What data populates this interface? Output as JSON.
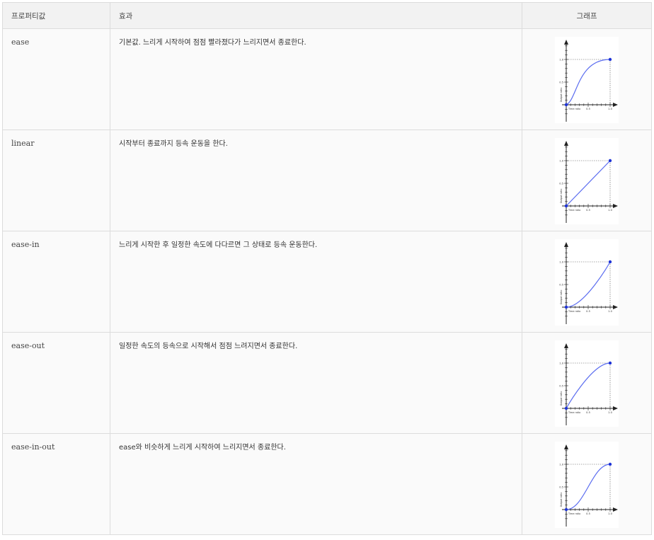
{
  "table": {
    "headers": {
      "property": "프로퍼티값",
      "effect": "효과",
      "graph": "그래프"
    },
    "rows": [
      {
        "value": "ease",
        "effect": "기본값. 느리게 시작하여 점점 빨라졌다가 느리지면서 종료한다.",
        "curve": "ease"
      },
      {
        "value": "linear",
        "effect": "시작부터 종료까지 등속 운동을 한다.",
        "curve": "linear"
      },
      {
        "value": "ease-in",
        "effect": "느리게 시작한 후 일정한 속도에 다다르면 그 상태로 등속 운동한다.",
        "curve": "ease-in"
      },
      {
        "value": "ease-out",
        "effect": "일정한 속도의 등속으로 시작해서 점점 느려지면서 종료한다.",
        "curve": "ease-out"
      },
      {
        "value": "ease-in-out",
        "effect": "ease와 비슷하게 느리게 시작하여 느리지면서 종료한다.",
        "curve": "ease-in-out"
      }
    ],
    "graph_labels": {
      "y_axis": "Output ratio",
      "x_axis": "Time ratio",
      "tick_half": "0.5",
      "tick_one": "1.0"
    }
  },
  "colors": {
    "curve": "#5a6cf0",
    "point": "#1f34d6",
    "axis": "#222222"
  }
}
